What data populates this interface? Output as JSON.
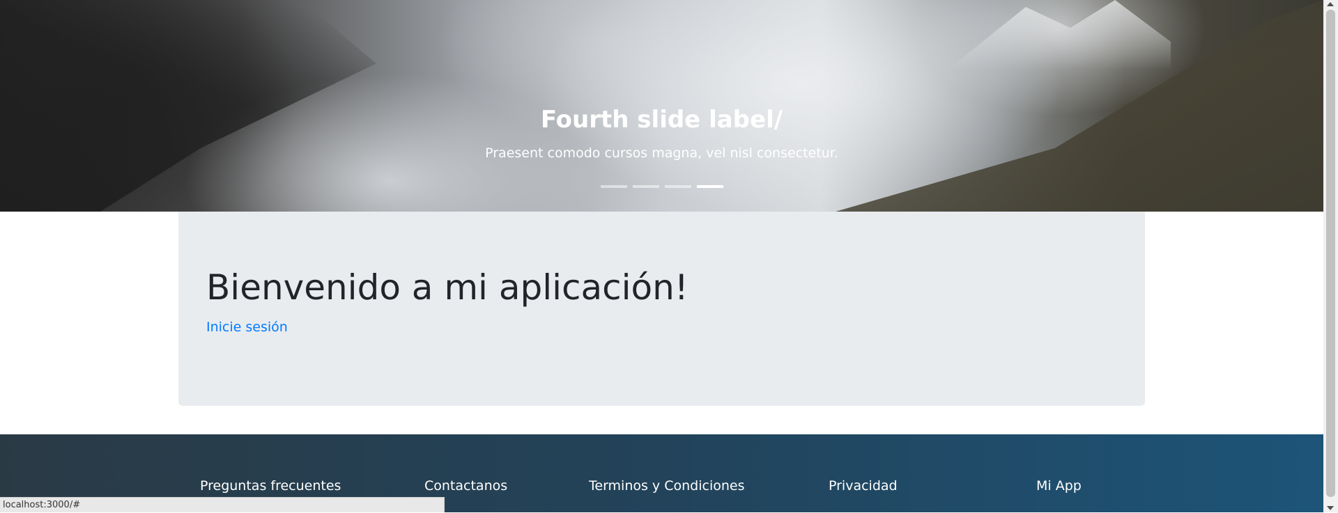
{
  "carousel": {
    "caption_title": "Fourth slide label/",
    "caption_text": "Praesent comodo cursos magna, vel nisl consectetur.",
    "slides_count": 4,
    "active_slide": 4
  },
  "jumbotron": {
    "title": "Bienvenido a mi aplicación!",
    "link": "Inicie sesión"
  },
  "footer": {
    "links": [
      "Preguntas frecuentes",
      "Contactanos",
      "Terminos y Condiciones",
      "Privacidad",
      "Mi App"
    ]
  },
  "status_bar": {
    "url": "localhost:3000/#"
  }
}
